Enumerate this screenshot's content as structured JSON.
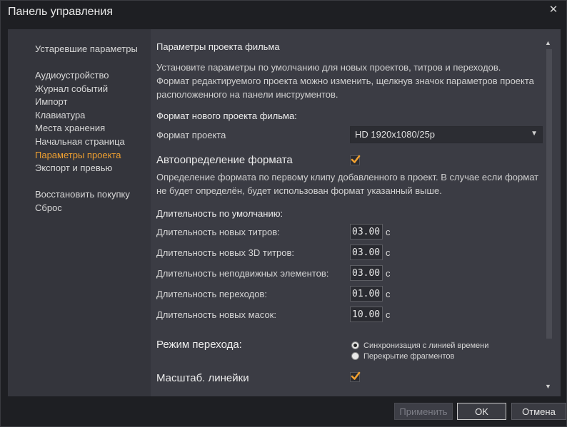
{
  "window": {
    "title": "Панель управления",
    "close_glyph": "✕"
  },
  "sidebar": {
    "items": [
      {
        "label": "Устаревшие параметры"
      },
      {
        "label": "Аудиоустройство"
      },
      {
        "label": "Журнал событий"
      },
      {
        "label": "Импорт"
      },
      {
        "label": "Клавиатура"
      },
      {
        "label": "Места хранения"
      },
      {
        "label": "Начальная страница"
      },
      {
        "label": "Параметры проекта",
        "active": true
      },
      {
        "label": "Экспорт и превью"
      },
      {
        "label": "Восстановить покупку"
      },
      {
        "label": "Сброс"
      }
    ]
  },
  "content": {
    "heading": "Параметры проекта фильма",
    "description": "Установите параметры по умолчанию для новых проектов, титров и переходов. Формат редактируемого проекта можно изменить, щелкнув значок параметров проекта расположенного на панели инструментов.",
    "format_section": "Формат нового проекта фильма:",
    "format_label": "Формат проекта",
    "format_value": "HD 1920x1080/25p",
    "auto_detect_label": "Автоопределение формата",
    "auto_detect_checked": true,
    "auto_detect_desc": "Определение формата по первому клипу добавленного в проект. В случае если формат не будет определён, будет использован формат указанный выше.",
    "duration_section": "Длительность по умолчанию:",
    "durations": [
      {
        "label": "Длительность новых титров:",
        "value": "03.00",
        "unit": "с"
      },
      {
        "label": "Длительность новых 3D титров:",
        "value": "03.00",
        "unit": "с"
      },
      {
        "label": "Длительность неподвижных элементов:",
        "value": "03.00",
        "unit": "с"
      },
      {
        "label": "Длительность переходов:",
        "value": "01.00",
        "unit": "с"
      },
      {
        "label": "Длительность новых масок:",
        "value": "10.00",
        "unit": "с"
      }
    ],
    "transition_mode_label": "Режим перехода:",
    "transition_options": [
      {
        "label": "Синхронизация с линией времени",
        "selected": true
      },
      {
        "label": "Перекрытие фрагментов",
        "selected": false
      }
    ],
    "ruler_scale_label": "Масштаб. линейки",
    "ruler_scale_checked": true
  },
  "buttons": {
    "apply": "Применить",
    "ok": "OK",
    "cancel": "Отмена"
  },
  "colors": {
    "accent": "#f0a030",
    "background": "#1e1f23",
    "panel": "#3b3c44"
  }
}
